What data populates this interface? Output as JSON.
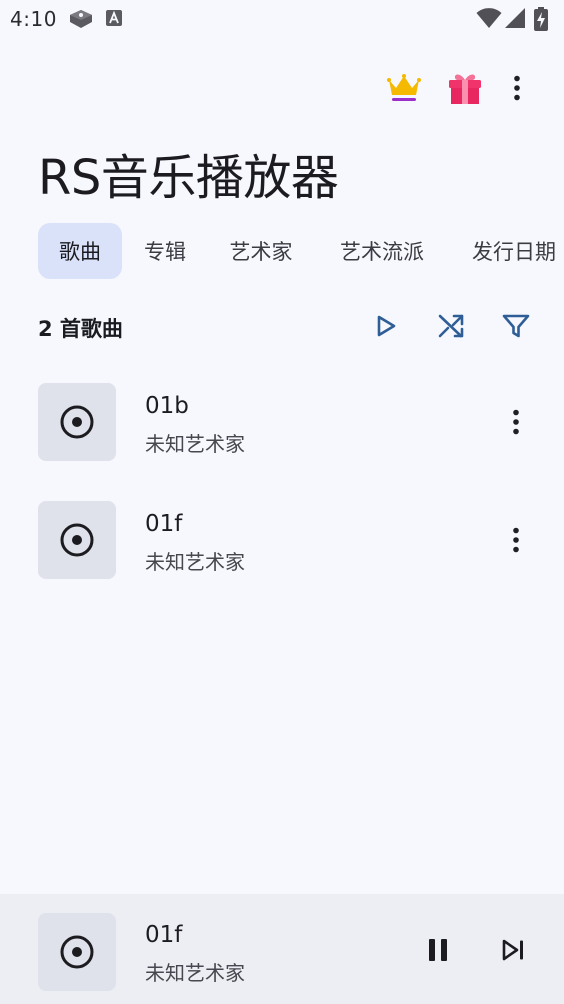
{
  "status_bar": {
    "time": "4:10",
    "left_icons": [
      "storage-icon",
      "font-a-icon"
    ],
    "right_icons": [
      "wifi-icon",
      "cell-signal-icon",
      "battery-charging-icon"
    ]
  },
  "top_actions": {
    "icons": [
      "crown-icon",
      "gift-icon",
      "more-vert-icon"
    ],
    "crown_color": "#f5b900",
    "crown_bar_color": "#9b2fc9",
    "gift_color": "#f0336b"
  },
  "app": {
    "title": "RS音乐播放器"
  },
  "tabs": [
    {
      "label": "歌曲",
      "active": true
    },
    {
      "label": "专辑",
      "active": false
    },
    {
      "label": "艺术家",
      "active": false
    },
    {
      "label": "艺术流派",
      "active": false
    },
    {
      "label": "发行日期",
      "active": false
    }
  ],
  "list_header": {
    "count_label": "2 首歌曲",
    "icons": [
      "play-icon",
      "shuffle-icon",
      "filter-icon"
    ],
    "icon_color": "#2f5e96"
  },
  "songs": [
    {
      "title": "01b",
      "artist": "未知艺术家"
    },
    {
      "title": "01f",
      "artist": "未知艺术家"
    }
  ],
  "now_playing": {
    "title": "01f",
    "artist": "未知艺术家",
    "icons": [
      "pause-icon",
      "skip-next-icon"
    ]
  },
  "colors": {
    "background": "#f7f8fe",
    "active_tab": "#dae2f9",
    "thumb_bg": "#dfe2eb",
    "player_bar_bg": "#edeef4"
  }
}
